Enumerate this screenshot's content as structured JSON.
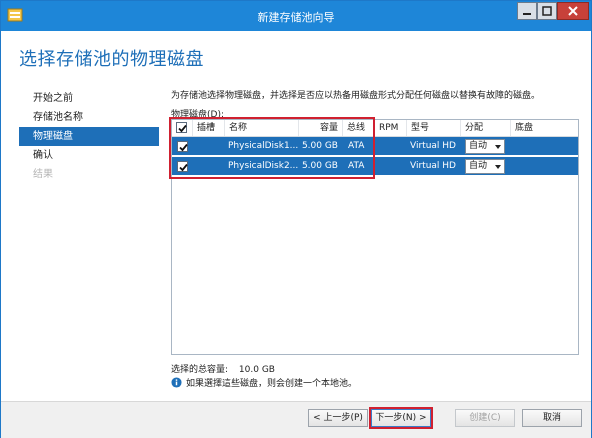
{
  "window": {
    "title": "新建存储池向导"
  },
  "page": {
    "heading": "选择存储池的物理磁盘"
  },
  "nav": {
    "items": [
      {
        "label": "开始之前",
        "state": "normal"
      },
      {
        "label": "存储池名称",
        "state": "normal"
      },
      {
        "label": "物理磁盘",
        "state": "active"
      },
      {
        "label": "确认",
        "state": "normal"
      },
      {
        "label": "结果",
        "state": "disabled"
      }
    ]
  },
  "main": {
    "description": "为存储池选择物理磁盘，并选择是否应以热备用磁盘形式分配任何磁盘以替换有故障的磁盘。",
    "table_label": "物理磁盘(D):",
    "columns": [
      "插槽",
      "名称",
      "容量",
      "总线",
      "RPM",
      "型号",
      "分配",
      "底盘"
    ],
    "rows": [
      {
        "checked": true,
        "slot": "",
        "name": "PhysicalDisk1...",
        "capacity": "5.00 GB",
        "bus": "ATA",
        "rpm": "",
        "model": "Virtual HD",
        "allocation": "自动",
        "chassis": ""
      },
      {
        "checked": true,
        "slot": "",
        "name": "PhysicalDisk2...",
        "capacity": "5.00 GB",
        "bus": "ATA",
        "rpm": "",
        "model": "Virtual HD",
        "allocation": "自动",
        "chassis": ""
      }
    ],
    "total_label": "选择的总容量:",
    "total_value": "10.0 GB",
    "info_text": "如果選擇這些磁盘，则会创建一个本地池。"
  },
  "footer": {
    "prev_label": "< 上一步(P)",
    "next_label": "下一步(N) >",
    "create_label": "创建(C)",
    "cancel_label": "取消"
  },
  "colors": {
    "accent": "#1e6fb8",
    "titlebar": "#1e86d8",
    "highlight_box": "#d02030"
  }
}
